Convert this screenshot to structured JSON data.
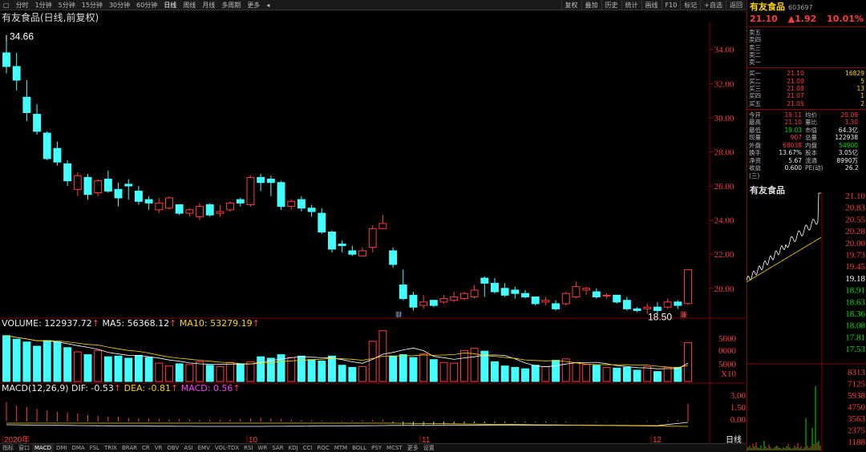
{
  "toolbar": {
    "tabs": [
      "分时",
      "1分钟",
      "5分钟",
      "15分钟",
      "30分钟",
      "60分钟",
      "日线",
      "周线",
      "月线",
      "多周期",
      "更多"
    ],
    "active_tab": "日线",
    "buttons": [
      "复权",
      "叠加",
      "历史",
      "统计",
      "画线",
      "F10",
      "标记",
      "+自选",
      "返回"
    ]
  },
  "chart": {
    "title": "有友食品(日线,前复权)",
    "high_label": "34.66",
    "low_label": "18.50",
    "price_axis": [
      "34.00",
      "32.00",
      "30.00",
      "28.00",
      "26.00",
      "24.00",
      "22.00",
      "20.00"
    ],
    "months": [
      "2020年",
      "10",
      "11",
      "12"
    ],
    "marker_cai": "财",
    "marker_zhang": "涨"
  },
  "volume": {
    "label": "VOLUME: 122937.72",
    "ma5": "MA5: 56368.12",
    "ma10": "MA10: 53279.19",
    "axis": [
      "5000",
      "0000",
      "5000",
      "X10"
    ]
  },
  "macd": {
    "label": "MACD(12,26,9)",
    "dif": "DIF: -0.53",
    "dea": "DEA: -0.81",
    "macd": "MACD: 0.56",
    "axis": [
      "3.00",
      "1.50",
      "0.00"
    ]
  },
  "bottom_tabs": [
    "指标",
    "窗口",
    "MACD",
    "DMI",
    "DMA",
    "FSL",
    "TRIX",
    "BRAR",
    "CR",
    "VR",
    "OBV",
    "ASI",
    "EMV",
    "VOL-TDX",
    "RSI",
    "WR",
    "SAR",
    "KDJ",
    "CCI",
    "ROC",
    "MTM",
    "BOLL",
    "PSY",
    "MCST",
    "更多",
    "设置"
  ],
  "bottom_right": "日线",
  "quote": {
    "name": "有友食品",
    "code": "603697",
    "price": "21.10",
    "change": "▲1.92",
    "pct": "10.01%",
    "sells": [
      {
        "label": "卖五",
        "price": "",
        "vol": ""
      },
      {
        "label": "卖四",
        "price": "",
        "vol": ""
      },
      {
        "label": "卖三",
        "price": "",
        "vol": ""
      },
      {
        "label": "卖二",
        "price": "",
        "vol": ""
      },
      {
        "label": "卖一",
        "price": "",
        "vol": ""
      }
    ],
    "buys": [
      {
        "label": "买一",
        "price": "21.10",
        "vol": "16829"
      },
      {
        "label": "买二",
        "price": "21.09",
        "vol": "5"
      },
      {
        "label": "买三",
        "price": "21.08",
        "vol": "13"
      },
      {
        "label": "买四",
        "price": "21.07",
        "vol": "1"
      },
      {
        "label": "买五",
        "price": "21.05",
        "vol": "2"
      }
    ],
    "stats": [
      [
        "今开",
        "19.11",
        "均价",
        "20.09"
      ],
      [
        "最高",
        "21.10",
        "量比",
        "3.30"
      ],
      [
        "最低",
        "19.03",
        "市值",
        "64.3亿"
      ],
      [
        "现量",
        "907",
        "总量",
        "122938"
      ],
      [
        "外盘",
        "68038",
        "内盘",
        "54900"
      ],
      [
        "换手",
        "13.67%",
        "股本",
        "3.05亿"
      ],
      [
        "净资",
        "5.67",
        "流通",
        "8990万"
      ],
      [
        "收益(三)",
        "0.600",
        "PE(动)",
        "26.2"
      ]
    ]
  },
  "mini": {
    "name": "有友食品",
    "price_axis": [
      "21.10",
      "20.83",
      "20.55",
      "20.28",
      "20.00",
      "19.73",
      "19.45",
      "19.18",
      "18.91",
      "18.63",
      "18.36",
      "18.08",
      "17.81",
      "17.53"
    ],
    "vol_axis": [
      "8313",
      "7125",
      "5938",
      "4750",
      "3563",
      "2375",
      "1188"
    ]
  },
  "chart_data": {
    "type": "candlestick",
    "price_range": [
      18.3,
      35.3
    ],
    "candles": [
      [
        33.8,
        34.66,
        32.6,
        33.0
      ],
      [
        33.0,
        33.8,
        31.6,
        32.2
      ],
      [
        31.2,
        32.2,
        29.8,
        30.3
      ],
      [
        30.2,
        30.8,
        29.0,
        29.2
      ],
      [
        29.1,
        29.2,
        27.5,
        27.6
      ],
      [
        28.2,
        28.6,
        27.2,
        27.4
      ],
      [
        27.3,
        27.5,
        26.0,
        26.3
      ],
      [
        25.8,
        26.8,
        25.4,
        26.6
      ],
      [
        26.5,
        26.7,
        25.2,
        25.5
      ],
      [
        25.6,
        26.4,
        25.4,
        26.3
      ],
      [
        26.4,
        26.9,
        25.6,
        25.7
      ],
      [
        25.8,
        26.2,
        24.8,
        25.3
      ],
      [
        26.1,
        26.4,
        25.2,
        26.0
      ],
      [
        25.7,
        26.0,
        24.9,
        25.1
      ],
      [
        25.2,
        25.4,
        24.6,
        25.0
      ],
      [
        24.6,
        25.3,
        24.4,
        25.0
      ],
      [
        24.7,
        25.4,
        24.6,
        25.3
      ],
      [
        24.9,
        24.9,
        24.3,
        24.4
      ],
      [
        24.4,
        24.7,
        24.2,
        24.6
      ],
      [
        24.2,
        25.0,
        24.0,
        24.8
      ],
      [
        24.9,
        25.0,
        24.2,
        24.3
      ],
      [
        24.4,
        24.9,
        24.2,
        24.5
      ],
      [
        24.6,
        25.1,
        24.5,
        25.0
      ],
      [
        25.2,
        25.3,
        24.8,
        25.0
      ],
      [
        24.9,
        26.6,
        24.8,
        26.5
      ],
      [
        26.5,
        26.7,
        25.7,
        26.2
      ],
      [
        26.4,
        26.6,
        25.4,
        26.2
      ],
      [
        26.2,
        26.3,
        24.6,
        24.8
      ],
      [
        24.8,
        25.2,
        24.6,
        25.1
      ],
      [
        25.2,
        25.4,
        24.5,
        24.7
      ],
      [
        24.7,
        24.9,
        24.2,
        24.5
      ],
      [
        24.4,
        24.7,
        23.2,
        23.3
      ],
      [
        23.3,
        23.4,
        22.1,
        22.3
      ],
      [
        22.6,
        22.8,
        22.1,
        22.5
      ],
      [
        22.2,
        22.5,
        21.9,
        22.0
      ],
      [
        21.9,
        22.4,
        21.9,
        22.2
      ],
      [
        22.4,
        23.7,
        22.1,
        23.5
      ],
      [
        23.5,
        24.3,
        23.5,
        23.8
      ],
      [
        22.2,
        22.4,
        21.2,
        21.4
      ],
      [
        20.2,
        21.1,
        19.3,
        19.4
      ],
      [
        19.6,
        19.8,
        18.7,
        18.9
      ],
      [
        19.0,
        19.6,
        18.8,
        19.2
      ],
      [
        19.3,
        19.3,
        18.9,
        19.0
      ],
      [
        19.2,
        19.6,
        19.1,
        19.4
      ],
      [
        19.3,
        19.8,
        19.2,
        19.5
      ],
      [
        19.4,
        19.8,
        19.3,
        19.7
      ],
      [
        19.5,
        20.2,
        19.4,
        19.9
      ],
      [
        20.6,
        20.7,
        19.5,
        20.3
      ],
      [
        20.3,
        20.6,
        19.7,
        19.8
      ],
      [
        20.0,
        20.3,
        19.5,
        19.6
      ],
      [
        19.9,
        20.1,
        19.4,
        19.7
      ],
      [
        19.7,
        19.9,
        19.4,
        19.5
      ],
      [
        19.5,
        19.5,
        19.0,
        19.1
      ],
      [
        19.2,
        19.5,
        19.0,
        19.3
      ],
      [
        19.1,
        19.3,
        18.7,
        18.8
      ],
      [
        19.1,
        19.8,
        19.0,
        19.7
      ],
      [
        19.5,
        20.4,
        19.4,
        20.1
      ],
      [
        19.9,
        20.1,
        19.6,
        20.0
      ],
      [
        19.8,
        20.0,
        19.4,
        19.5
      ],
      [
        19.6,
        19.7,
        19.4,
        19.6
      ],
      [
        19.6,
        19.6,
        19.1,
        19.2
      ],
      [
        19.3,
        19.5,
        18.7,
        18.8
      ],
      [
        18.8,
        18.9,
        18.6,
        18.7
      ],
      [
        18.8,
        19.1,
        18.5,
        18.9
      ],
      [
        18.9,
        19.2,
        18.5,
        18.7
      ],
      [
        18.9,
        19.4,
        18.8,
        19.2
      ],
      [
        19.2,
        19.3,
        18.8,
        19.0
      ],
      [
        19.11,
        21.1,
        19.03,
        21.1
      ]
    ],
    "volume": [
      6.5,
      6.0,
      5.6,
      5.0,
      5.8,
      5.6,
      4.8,
      4.2,
      3.8,
      4.4,
      3.5,
      3.6,
      3.3,
      3.7,
      3.4,
      2.6,
      2.2,
      2.5,
      2.4,
      2.8,
      2.3,
      2.1,
      2.7,
      2.5,
      2.8,
      3.5,
      3.3,
      3.8,
      3.4,
      3.6,
      3.1,
      2.9,
      3.6,
      2.3,
      2.0,
      2.1,
      5.7,
      7.2,
      3.6,
      3.8,
      3.4,
      3.9,
      3.1,
      2.7,
      2.6,
      4.4,
      4.7,
      4.3,
      2.8,
      2.2,
      2.0,
      1.8,
      2.3,
      2.1,
      3.0,
      3.2,
      2.7,
      2.4,
      2.3,
      2.0,
      1.9,
      2.0,
      1.6,
      2.1,
      1.4,
      2.0,
      2.0,
      5.5
    ],
    "macd_hist": [
      0.6,
      0.5,
      0.45,
      0.4,
      0.35,
      0.3,
      0.28,
      0.25,
      0.2,
      0.18,
      0.15,
      0.15,
      0.12,
      0.1,
      0.1,
      0.08,
      0.07,
      0.08,
      0.06,
      0.05,
      0.06,
      0.05,
      0.07,
      0.08,
      0.1,
      0.12,
      0.1,
      0.08,
      0.06,
      0.05,
      0.04,
      0.03,
      0.02,
      0.02,
      0.03,
      0.04,
      0.05,
      0.06,
      -0.05,
      -0.1,
      -0.12,
      -0.12,
      -0.1,
      -0.09,
      -0.08,
      -0.06,
      -0.05,
      -0.05,
      -0.04,
      -0.04,
      -0.03,
      -0.03,
      -0.02,
      -0.03,
      -0.02,
      -0.02,
      -0.01,
      -0.01,
      -0.02,
      -0.01,
      -0.01,
      0.01,
      0.01,
      0.02,
      0.02,
      0.03,
      0.04,
      0.56
    ]
  }
}
